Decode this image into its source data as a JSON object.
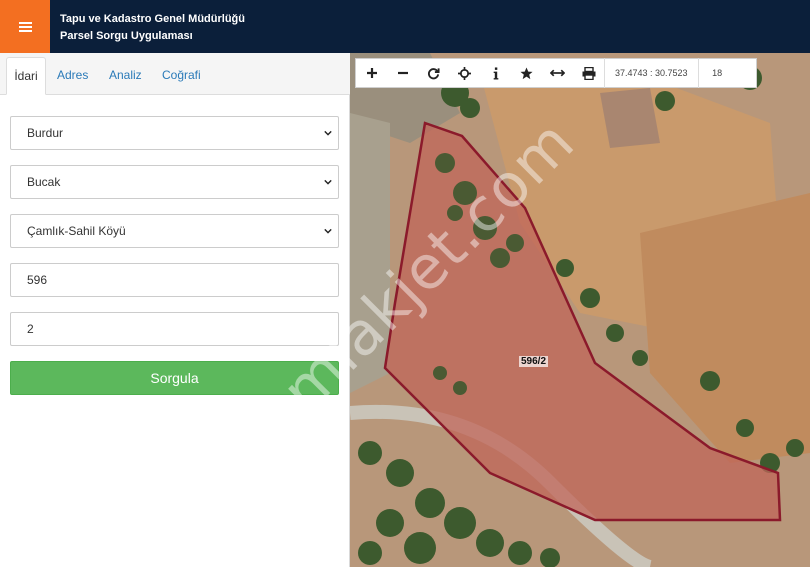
{
  "header": {
    "title_line1": "Tapu ve Kadastro Genel Müdürlüğü",
    "title_line2": "Parsel Sorgu Uygulaması"
  },
  "tabs": [
    "İdari",
    "Adres",
    "Analiz",
    "Coğrafi"
  ],
  "form": {
    "il": "Burdur",
    "ilce": "Bucak",
    "mahalle": "Çamlık-Sahil Köyü",
    "ada": "596",
    "parsel": "2",
    "submit_label": "Sorgula"
  },
  "map": {
    "coordinates": "37.4743 : 30.7523",
    "zoom": "18",
    "parcel_label": "596/2",
    "watermark": "emlakjet.com"
  },
  "colors": {
    "header_bg": "#0b1f3a",
    "menu_accent": "#f36f21",
    "submit_green": "#5cb85c",
    "parcel_outline": "#8b1a2b"
  }
}
